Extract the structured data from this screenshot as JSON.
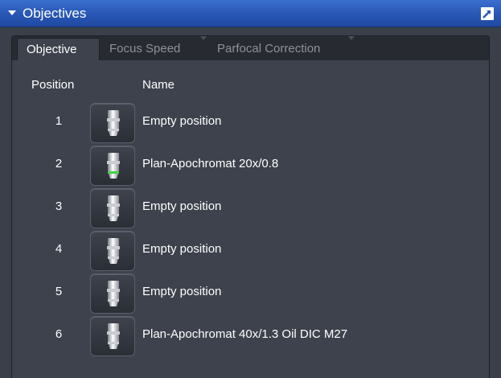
{
  "header": {
    "title": "Objectives",
    "expand_icon": "disclosure-triangle-down",
    "undock_icon": "undock-arrow"
  },
  "tabs": [
    {
      "label": "Objective",
      "active": true
    },
    {
      "label": "Focus Speed",
      "active": false
    },
    {
      "label": "Parfocal Correction",
      "active": false
    }
  ],
  "columns": {
    "position": "Position",
    "name": "Name"
  },
  "objectives": [
    {
      "position": "1",
      "name": "Empty position",
      "icon": "objective-lens-icon",
      "ring_color": ""
    },
    {
      "position": "2",
      "name": "Plan-Apochromat 20x/0.8",
      "icon": "objective-lens-icon",
      "ring_color": "#3fd43f"
    },
    {
      "position": "3",
      "name": "Empty position",
      "icon": "objective-lens-icon",
      "ring_color": ""
    },
    {
      "position": "4",
      "name": "Empty position",
      "icon": "objective-lens-icon",
      "ring_color": ""
    },
    {
      "position": "5",
      "name": "Empty position",
      "icon": "objective-lens-icon",
      "ring_color": ""
    },
    {
      "position": "6",
      "name": "Plan-Apochromat 40x/1.3 Oil DIC M27",
      "icon": "objective-lens-icon",
      "ring_color": ""
    }
  ],
  "colors": {
    "title_bar": "#2856b4",
    "panel_bg": "#3d424c",
    "accent_ring": "#3fd43f"
  }
}
